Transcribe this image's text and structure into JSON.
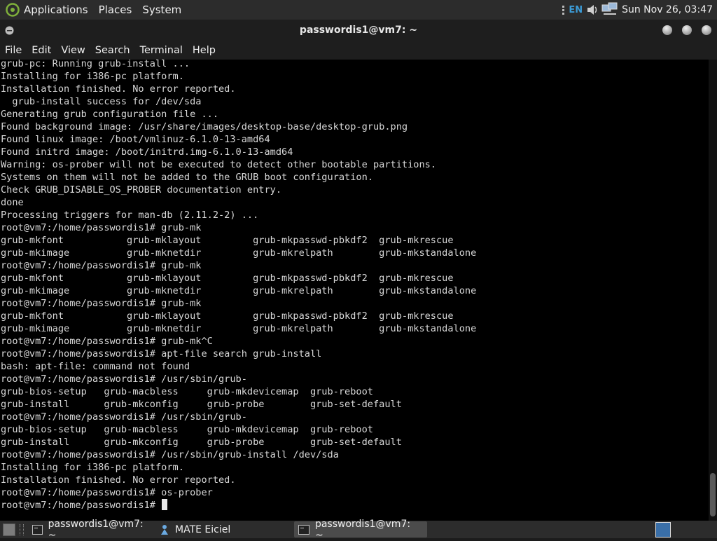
{
  "top_panel": {
    "menu": [
      "Applications",
      "Places",
      "System"
    ],
    "lang": "EN",
    "clock": "Sun Nov 26, 03:47"
  },
  "window": {
    "title": "passwordis1@vm7: ~",
    "menu": [
      "File",
      "Edit",
      "View",
      "Search",
      "Terminal",
      "Help"
    ]
  },
  "terminal": {
    "lines": [
      "grub-pc: Running grub-install ...",
      "Installing for i386-pc platform.",
      "Installation finished. No error reported.",
      "  grub-install success for /dev/sda",
      "Generating grub configuration file ...",
      "Found background image: /usr/share/images/desktop-base/desktop-grub.png",
      "Found linux image: /boot/vmlinuz-6.1.0-13-amd64",
      "Found initrd image: /boot/initrd.img-6.1.0-13-amd64",
      "Warning: os-prober will not be executed to detect other bootable partitions.",
      "Systems on them will not be added to the GRUB boot configuration.",
      "Check GRUB_DISABLE_OS_PROBER documentation entry.",
      "done",
      "Processing triggers for man-db (2.11.2-2) ...",
      "root@vm7:/home/passwordis1# grub-mk",
      "grub-mkfont           grub-mklayout         grub-mkpasswd-pbkdf2  grub-mkrescue",
      "grub-mkimage          grub-mknetdir         grub-mkrelpath        grub-mkstandalone",
      "root@vm7:/home/passwordis1# grub-mk",
      "grub-mkfont           grub-mklayout         grub-mkpasswd-pbkdf2  grub-mkrescue",
      "grub-mkimage          grub-mknetdir         grub-mkrelpath        grub-mkstandalone",
      "root@vm7:/home/passwordis1# grub-mk",
      "grub-mkfont           grub-mklayout         grub-mkpasswd-pbkdf2  grub-mkrescue",
      "grub-mkimage          grub-mknetdir         grub-mkrelpath        grub-mkstandalone",
      "root@vm7:/home/passwordis1# grub-mk^C",
      "root@vm7:/home/passwordis1# apt-file search grub-install",
      "bash: apt-file: command not found",
      "root@vm7:/home/passwordis1# /usr/sbin/grub-",
      "grub-bios-setup   grub-macbless     grub-mkdevicemap  grub-reboot",
      "grub-install      grub-mkconfig     grub-probe        grub-set-default",
      "root@vm7:/home/passwordis1# /usr/sbin/grub-",
      "grub-bios-setup   grub-macbless     grub-mkdevicemap  grub-reboot",
      "grub-install      grub-mkconfig     grub-probe        grub-set-default",
      "root@vm7:/home/passwordis1# /usr/sbin/grub-install /dev/sda",
      "Installing for i386-pc platform.",
      "Installation finished. No error reported.",
      "root@vm7:/home/passwordis1# os-prober",
      "root@vm7:/home/passwordis1# "
    ]
  },
  "taskbar": {
    "tasks": [
      {
        "label": "passwordis1@vm7: ~",
        "active": false
      },
      {
        "label": "MATE Eiciel",
        "active": false
      },
      {
        "label": "passwordis1@vm7: ~",
        "active": true
      }
    ]
  },
  "colors": {
    "panel_bg": "#2c2c2c",
    "terminal_bg": "#000000",
    "terminal_fg": "#d8d8d8",
    "lang_accent": "#3c9bd6"
  },
  "icons": [
    "mate-logo-icon",
    "volume-icon",
    "network-icon",
    "window-menu-icon",
    "terminal-icon",
    "eiciel-icon",
    "show-desktop-icon",
    "workspace-switcher-icon"
  ]
}
